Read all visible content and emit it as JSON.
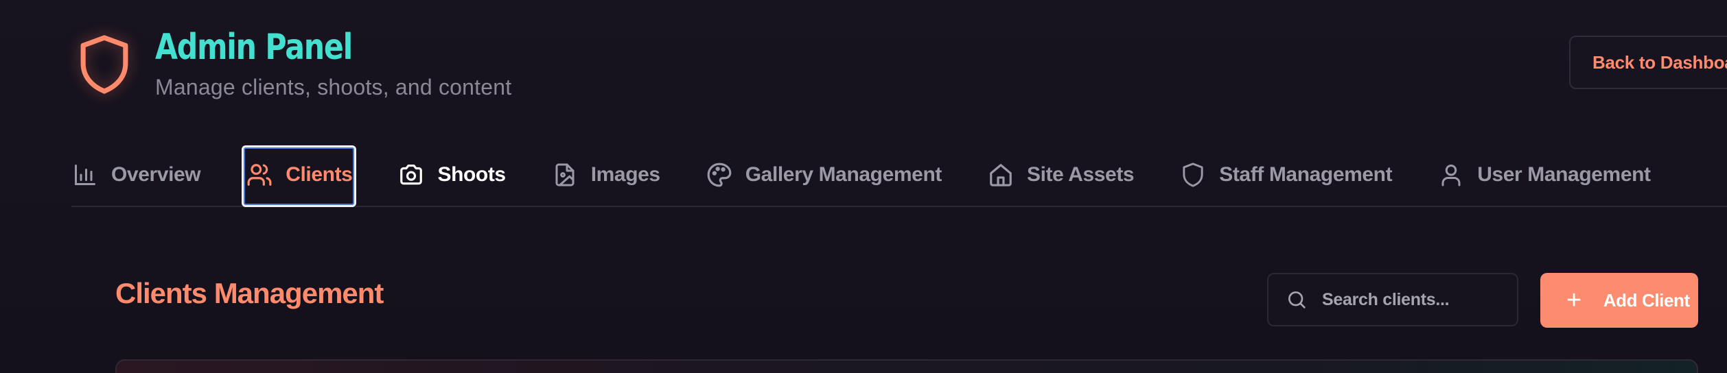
{
  "header": {
    "title": "Admin Panel",
    "subtitle": "Manage clients, shoots, and content",
    "back_button": "Back to Dashboard"
  },
  "tabs": [
    {
      "label": "Overview",
      "icon": "bar-chart-icon",
      "state": "default"
    },
    {
      "label": "Clients",
      "icon": "users-icon",
      "state": "active"
    },
    {
      "label": "Shoots",
      "icon": "camera-icon",
      "state": "hover"
    },
    {
      "label": "Images",
      "icon": "image-file-icon",
      "state": "default"
    },
    {
      "label": "Gallery Management",
      "icon": "palette-icon",
      "state": "default"
    },
    {
      "label": "Site Assets",
      "icon": "home-icon",
      "state": "default"
    },
    {
      "label": "Staff Management",
      "icon": "shield-icon",
      "state": "default"
    },
    {
      "label": "User Management",
      "icon": "user-icon",
      "state": "default"
    }
  ],
  "section": {
    "title": "Clients Management",
    "search_placeholder": "Search clients...",
    "add_button": "Add Client"
  },
  "colors": {
    "accent": "#fb8c6f",
    "brand_teal": "#43e0d0",
    "background": "#16121f"
  }
}
